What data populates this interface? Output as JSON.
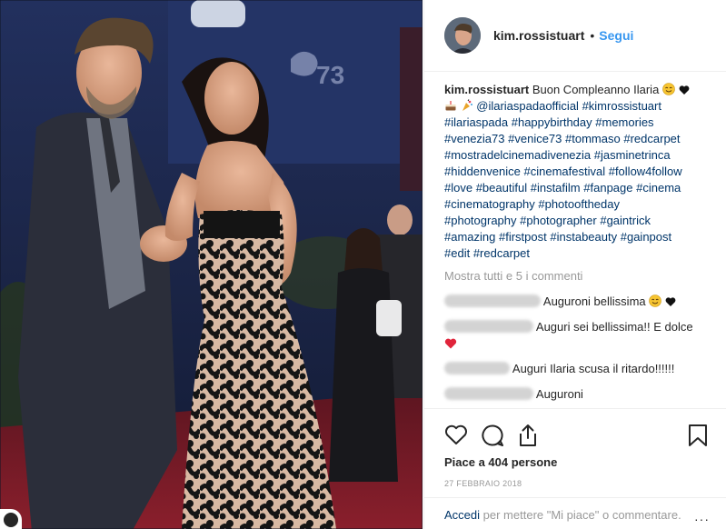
{
  "header": {
    "username": "kim.rossistuart",
    "separator": "•",
    "follow_label": "Segui"
  },
  "caption": {
    "username": "kim.rossistuart",
    "text": "Buon Compleanno Ilaria",
    "mention": "@ilariaspadaofficial",
    "tags_line2": [
      "#kimrossistuart"
    ],
    "tag_lines": [
      [
        "#ilariaspada",
        "#happybirthday",
        "#memories"
      ],
      [
        "#venezia73",
        "#venice73",
        "#tommaso",
        "#redcarpet"
      ],
      [
        "#mostradelcinemadivenezia",
        "#jasminetrinca"
      ],
      [
        "#hiddenvenice",
        "#cinemafestival",
        "#follow4follow"
      ],
      [
        "#love",
        "#beautiful",
        "#instafilm",
        "#fanpage",
        "#cinema"
      ],
      [
        "#cinematography",
        "#photooftheday"
      ],
      [
        "#photography",
        "#photographer",
        "#gaintrick"
      ],
      [
        "#amazing",
        "#firstpost",
        "#instabeauty",
        "#gainpost"
      ],
      [
        "#edit",
        "#redcarpet"
      ]
    ]
  },
  "show_all_comments": "Mostra tutti e 5 i commenti",
  "comments": [
    {
      "user": "marina_peppe",
      "text": "Auguroni bellissima"
    },
    {
      "user": "rossanaraucci",
      "text": "Auguri sei bellissima!! E dolce"
    },
    {
      "user": "rossanerita",
      "text": "Auguri Ilaria scusa il ritardo!!!!!!"
    },
    {
      "user": "mary.gerganti",
      "text": "Auguroni"
    }
  ],
  "icons": {
    "like": "heart-outline-icon",
    "comment": "speech-bubble-icon",
    "share": "share-upload-icon",
    "save": "bookmark-icon",
    "more": "ellipsis-icon"
  },
  "likes_text": "Piace a 404 persone",
  "date_text": "27 FEBBRAIO 2018",
  "login": {
    "link": "Accedi",
    "text": "per mettere \"Mi piace\" o commentare.",
    "more": "···"
  },
  "photo": {
    "description_signage": "73",
    "colors": {
      "backdrop": "#1f2a52",
      "carpet": "#7a1a24",
      "suit": "#2b2e3a"
    }
  }
}
